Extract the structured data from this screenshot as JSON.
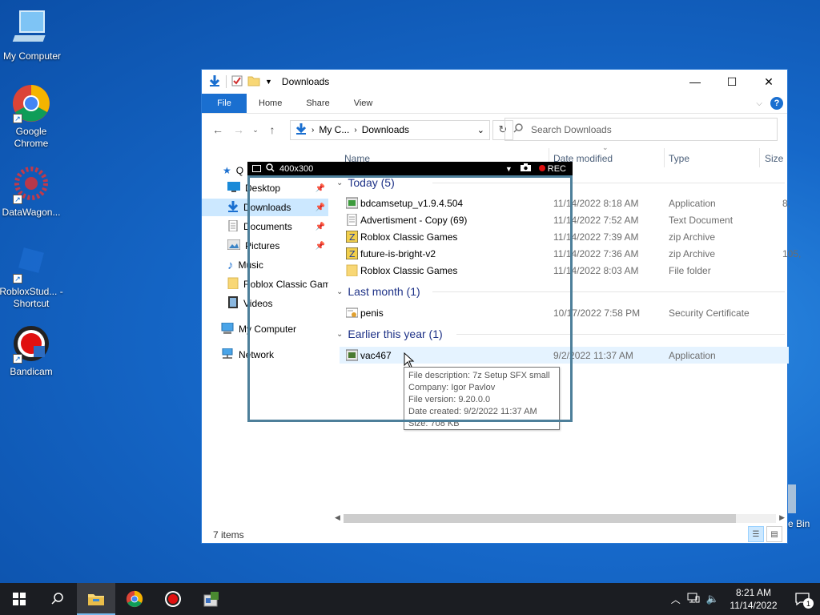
{
  "desktop": {
    "icons": [
      {
        "label": "My Computer"
      },
      {
        "label": "Google Chrome"
      },
      {
        "label": "DataWagon..."
      },
      {
        "label": "RobloxStud... - Shortcut"
      },
      {
        "label": "Bandicam"
      }
    ],
    "recycle_label": "e Bin"
  },
  "window": {
    "title": "Downloads",
    "tabs": {
      "file": "File",
      "home": "Home",
      "share": "Share",
      "view": "View"
    },
    "address": {
      "crumb1": "My C...",
      "crumb2": "Downloads"
    },
    "search_placeholder": "Search Downloads",
    "columns": {
      "name": "Name",
      "date": "Date modified",
      "type": "Type",
      "size": "Size"
    },
    "nav": {
      "quick": "Q",
      "desktop": "Desktop",
      "downloads": "Downloads",
      "documents": "Documents",
      "pictures": "Pictures",
      "music": "Music",
      "roblox": "Roblox Classic Gam",
      "videos": "Videos",
      "mycomputer": "My Computer",
      "network": "Network"
    },
    "groups": {
      "today": "Today (5)",
      "lastmonth": "Last month (1)",
      "earlier": "Earlier this year (1)"
    },
    "files": [
      {
        "name": "bdcamsetup_v1.9.4.504",
        "date": "11/14/2022 8:18 AM",
        "type": "Application",
        "size": "8,"
      },
      {
        "name": "Advertisment - Copy (69)",
        "date": "11/14/2022 7:52 AM",
        "type": "Text Document",
        "size": ""
      },
      {
        "name": "Roblox Classic Games",
        "date": "11/14/2022 7:39 AM",
        "type": "zip Archive",
        "size": ""
      },
      {
        "name": "future-is-bright-v2",
        "date": "11/14/2022 7:36 AM",
        "type": "zip Archive",
        "size": "105,"
      },
      {
        "name": "Roblox Classic Games",
        "date": "11/14/2022 8:03 AM",
        "type": "File folder",
        "size": ""
      },
      {
        "name": "penis",
        "date": "10/17/2022 7:58 PM",
        "type": "Security Certificate",
        "size": ""
      },
      {
        "name": "vac467",
        "date": "9/2/2022 11:37 AM",
        "type": "Application",
        "size": ""
      }
    ],
    "tooltip": {
      "desc": "File description: 7z Setup SFX small",
      "company": "Company: Igor Pavlov",
      "version": "File version: 9.20.0.0",
      "created": "Date created: 9/2/2022 11:37 AM",
      "size": "Size: 708 KB"
    },
    "status": "7 items"
  },
  "recorder": {
    "size": "400x300",
    "rec": "REC"
  },
  "taskbar": {
    "time": "8:21 AM",
    "date": "11/14/2022",
    "notif_count": "1"
  },
  "colors": {
    "accent": "#1a6fd0",
    "taskbar": "#1b1d22",
    "rec": "#e01010"
  }
}
